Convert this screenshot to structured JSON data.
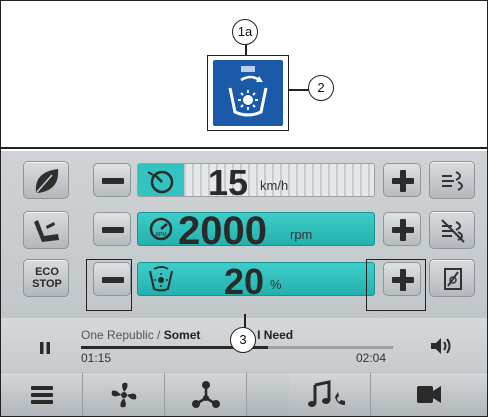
{
  "callouts": {
    "c1a": "1a",
    "c2": "2",
    "c3": "3"
  },
  "icons": {
    "top_symbol": "cab-heater-auto-icon",
    "eco": "leaf-icon",
    "seat": "seat-icon",
    "fan_row": "fan-icon",
    "speed_row": "speedometer-icon",
    "rpm_row": "rpm-gauge-icon",
    "right_1": "air-flow-icon",
    "right_2": "air-flow-off-icon",
    "right_3": "defrost-icon",
    "pause": "pause-icon",
    "volume": "volume-icon",
    "nav": [
      "menu-icon",
      "fan-icon",
      "network-icon",
      "music-phone-icon",
      "camera-icon"
    ]
  },
  "eco_stop": {
    "line1": "ECO",
    "line2": "STOP"
  },
  "rows": {
    "speed": {
      "value": "15",
      "unit": "km/h",
      "level": 0.0
    },
    "rpm": {
      "value": "2000",
      "unit": "rpm",
      "level": 1.0
    },
    "heater": {
      "value": "20",
      "unit": "%",
      "level": 1.0
    }
  },
  "media": {
    "artist": "One Republic / ",
    "title": "Somet",
    "title_tail": "g I Need",
    "elapsed": "01:15",
    "total": "02:04",
    "progress": 0.6
  },
  "colors": {
    "teal": "#33c3c0",
    "teal_dark": "#1aa5a3",
    "blue_icon": "#1a5aa8"
  }
}
